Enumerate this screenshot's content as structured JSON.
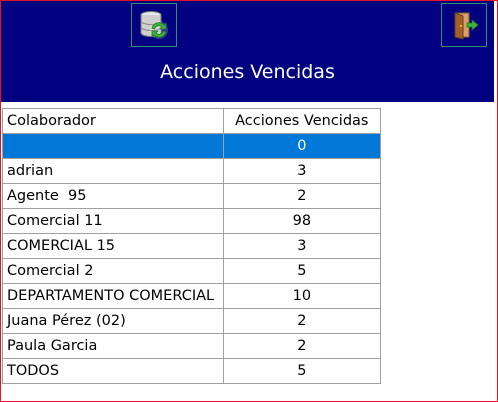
{
  "header": {
    "title": "Acciones Vencidas",
    "refresh_icon": "database-refresh-icon",
    "exit_icon": "exit-door-icon"
  },
  "table": {
    "columns": [
      "Colaborador",
      "Acciones Vencidas"
    ],
    "rows": [
      {
        "name": "",
        "value": "0",
        "selected": true
      },
      {
        "name": "adrian",
        "value": "3"
      },
      {
        "name": "Agente  95",
        "value": "2"
      },
      {
        "name": "Comercial 11",
        "value": "98"
      },
      {
        "name": "COMERCIAL 15",
        "value": "3"
      },
      {
        "name": "Comercial 2",
        "value": "5"
      },
      {
        "name": "DEPARTAMENTO COMERCIAL",
        "value": "10"
      },
      {
        "name": "Juana Pérez (02)",
        "value": "2"
      },
      {
        "name": "Paula Garcia",
        "value": "2"
      },
      {
        "name": "TODOS",
        "value": "5"
      }
    ]
  },
  "colors": {
    "header_bg": "#000080",
    "selection": "#0078d7",
    "window_border": "#e81123"
  }
}
